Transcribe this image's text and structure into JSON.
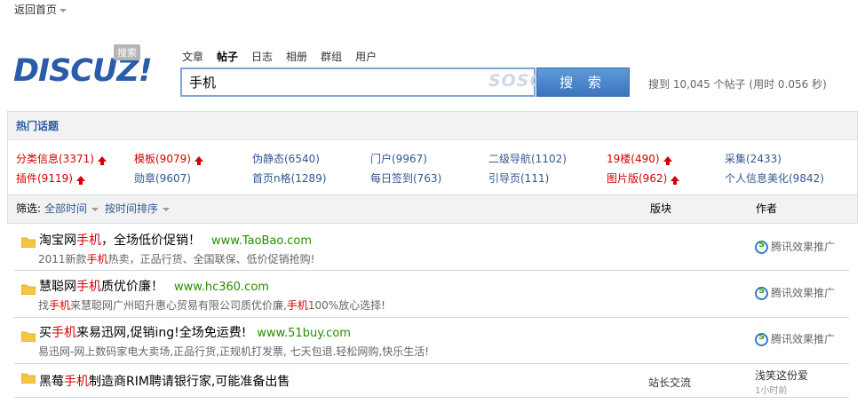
{
  "nav": {
    "back_home": "返回首页"
  },
  "logo": {
    "text": "DISCUZ!",
    "badge": "搜索"
  },
  "search": {
    "tabs": [
      "文章",
      "帖子",
      "日志",
      "相册",
      "群组",
      "用户"
    ],
    "active_tab": "帖子",
    "query": "手机",
    "engine_watermark": "SOSO",
    "button": "搜 索",
    "result_info": "搜到 10,045 个帖子 (用时 0.056 秒)"
  },
  "hot": {
    "title": "热门话题",
    "items": [
      {
        "label": "分类信息(3371)",
        "hot": true
      },
      {
        "label": "模板(9079)",
        "hot": true
      },
      {
        "label": "伪静态(6540)",
        "hot": false
      },
      {
        "label": "门户(9967)",
        "hot": false
      },
      {
        "label": "二级导航(1102)",
        "hot": false
      },
      {
        "label": "19楼(490)",
        "hot": true
      },
      {
        "label": "采集(2433)",
        "hot": false
      },
      {
        "label": "插件(9119)",
        "hot": true
      },
      {
        "label": "勋章(9607)",
        "hot": false
      },
      {
        "label": "首页n格(1289)",
        "hot": false
      },
      {
        "label": "每日签到(763)",
        "hot": false
      },
      {
        "label": "引导页(111)",
        "hot": false
      },
      {
        "label": "图片版(962)",
        "hot": true
      },
      {
        "label": "个人信息美化(9842)",
        "hot": false
      }
    ]
  },
  "filter": {
    "label": "筛选:",
    "time": "全部时间",
    "sort": "按时间排序",
    "col_forum": "版块",
    "col_author": "作者"
  },
  "results": [
    {
      "title_pre": "淘宝网",
      "title_hl": "手机",
      "title_post": "，全场低价促销！",
      "url": "www.TaoBao.com",
      "desc_pre": "2011新款",
      "desc_hl": "手机",
      "desc_post": "热卖，正品行货、全国联保、低价促销抢购!",
      "sponsor": "腾讯效果推广"
    },
    {
      "title_pre": "慧聪网",
      "title_hl": "手机",
      "title_post": "质优价廉！",
      "url": "www.hc360.com",
      "desc_pre": "找",
      "desc_hl": "手机",
      "desc_mid": "来慧聪网广州昭升惠心贸易有限公司质优价廉,",
      "desc_hl2": "手机",
      "desc_post": "100%放心选择!",
      "sponsor": "腾讯效果推广"
    },
    {
      "title_pre": "买",
      "title_hl": "手机",
      "title_post": "来易迅网,促销ing!全场免运费!",
      "url": "www.51buy.com",
      "desc_pre": "易迅网-网上数码家电大卖场,正品行货,正规机打发票, 七天包退.轻松网购,快乐生活!",
      "desc_hl": "",
      "desc_post": "",
      "sponsor": "腾讯效果推广"
    },
    {
      "title_pre": "黑莓",
      "title_hl": "手机",
      "title_post": "制造商RIM聘请银行家,可能准备出售",
      "forum": "站长交流",
      "author": "浅笑这份爱",
      "time": "1小时前"
    }
  ],
  "colors": {
    "accent": "#2a5caa",
    "highlight": "#d40000",
    "url": "#2a8c00"
  }
}
